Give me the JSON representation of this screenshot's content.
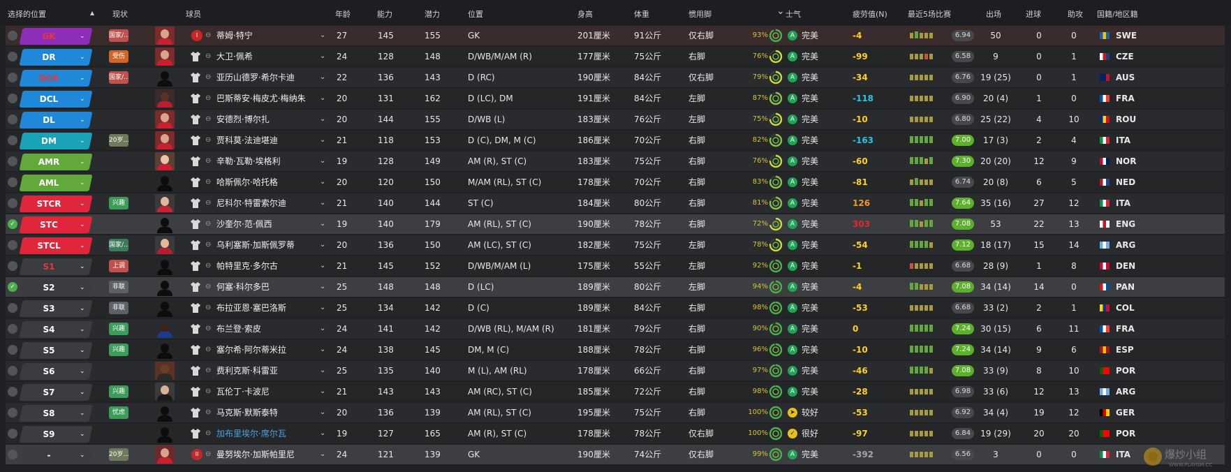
{
  "header": {
    "col_select": "选择的位置",
    "sort_indicator": "▲",
    "col_status": "现状",
    "col_player": "球员",
    "col_age": "年龄",
    "col_ability": "能力",
    "col_potential": "潜力",
    "col_position": "位置",
    "col_height": "身高",
    "col_weight": "体重",
    "col_foot": "惯用脚",
    "col_morale_arrow": "⌄",
    "col_morale": "士气",
    "col_value": "疲劳值(N)",
    "col_form": "最近5场比赛",
    "col_apps": "出场",
    "col_goals": "进球",
    "col_assists": "助攻",
    "col_nat": "国籍/地区籍"
  },
  "colors": {
    "red": "#e0263a",
    "blue": "#1f88d8",
    "teal": "#1aa3b8",
    "green": "#62a83a",
    "dark": "#3b3c40",
    "morale_icon_green": "#1ea453",
    "morale_icon_yellow": "#e3c01a",
    "value_yellow": "#ffd21f",
    "value_cyan": "#29c6dd",
    "value_orange": "#f29a1e",
    "value_red": "#e3262f",
    "value_grey": "#a4a5a8",
    "rating_green": "#5bb12a",
    "rating_grey": "#47484c"
  },
  "players": [
    {
      "pos": "GK",
      "pos_color": "#8e2dba",
      "pos_text": "#e53935",
      "status": "国家/...",
      "status_color": "#c0504d",
      "photo": "red",
      "badge": "I",
      "name": "蒂姆·特宁",
      "age": "27",
      "ca": "145",
      "pa": "155",
      "position": "GK",
      "height": "201厘米",
      "weight": "91公斤",
      "foot": "仅右脚",
      "morale_pct": "93%",
      "morale_icon": "A",
      "morale_icon_color": "#1ea453",
      "morale": "完美",
      "value": "-4",
      "value_color": "#ffd21f",
      "form": [
        "#a69a3d",
        "#62a83a",
        "#a69a3d",
        "#a69a3d",
        "#a69a3d"
      ],
      "rating": "6.94",
      "rating_hl": false,
      "apps": "50",
      "goals": "0",
      "assists": "0",
      "flag": [
        "#1f5fa8",
        "#f2c40f",
        "#1f5fa8"
      ],
      "nat": "SWE",
      "row": "gk"
    },
    {
      "pos": "DR",
      "pos_color": "#1f88d8",
      "pos_text": "#ffffff",
      "status": "受伤",
      "status_color": "#d0652a",
      "photo": "red",
      "name": "大卫·佩希",
      "age": "24",
      "ca": "128",
      "pa": "148",
      "position": "D/WB/M/AM (R)",
      "height": "177厘米",
      "weight": "75公斤",
      "foot": "右脚",
      "morale_pct": "76%",
      "morale_icon": "A",
      "morale_icon_color": "#1ea453",
      "morale": "完美",
      "value": "-99",
      "value_color": "#ffd21f",
      "form": [
        "#a69a3d",
        "#a69a3d",
        "#a69a3d",
        "#c7543c",
        "#a69a3d"
      ],
      "rating": "6.58",
      "rating_hl": false,
      "apps": "9",
      "goals": "0",
      "assists": "1",
      "flag": [
        "#ffffff",
        "#d7141a",
        "#11457e"
      ],
      "nat": "CZE",
      "row": "even"
    },
    {
      "pos": "DCR",
      "pos_color": "#1f88d8",
      "pos_text": "#e53935",
      "status": "国家/...",
      "status_color": "#c0504d",
      "photo": "none",
      "name": "亚历山德罗·希尔卡迪",
      "age": "22",
      "ca": "136",
      "pa": "143",
      "position": "D (RC)",
      "height": "190厘米",
      "weight": "84公斤",
      "foot": "仅右脚",
      "morale_pct": "79%",
      "morale_icon": "A",
      "morale_icon_color": "#1ea453",
      "morale": "完美",
      "value": "-34",
      "value_color": "#ffd21f",
      "form": [
        "#a69a3d",
        "#a69a3d",
        "#a69a3d",
        "#a69a3d",
        "#a69a3d"
      ],
      "rating": "6.76",
      "rating_hl": false,
      "apps": "19 (25)",
      "goals": "0",
      "assists": "1",
      "flag": [
        "#012169",
        "#012169",
        "#c8102e"
      ],
      "nat": "AUS",
      "row": "odd"
    },
    {
      "pos": "DCL",
      "pos_color": "#1f88d8",
      "pos_text": "#ffffff",
      "status": "",
      "status_color": "",
      "photo": "dark",
      "name": "巴斯蒂安·梅皮尤·梅纳朱",
      "age": "20",
      "ca": "131",
      "pa": "162",
      "position": "D (LC), DM",
      "height": "191厘米",
      "weight": "84公斤",
      "foot": "左脚",
      "morale_pct": "87%",
      "morale_icon": "A",
      "morale_icon_color": "#1ea453",
      "morale": "完美",
      "value": "-118",
      "value_color": "#29c6dd",
      "form": [
        "#a69a3d",
        "#a69a3d",
        "#a69a3d",
        "#a69a3d",
        "#a69a3d"
      ],
      "rating": "6.90",
      "rating_hl": false,
      "apps": "20 (4)",
      "goals": "1",
      "assists": "0",
      "flag": [
        "#0055a4",
        "#ffffff",
        "#ef4135"
      ],
      "nat": "FRA",
      "row": "even"
    },
    {
      "pos": "DL",
      "pos_color": "#1f88d8",
      "pos_text": "#ffffff",
      "status": "",
      "status_color": "",
      "photo": "red",
      "name": "安德烈·博尔扎",
      "age": "20",
      "ca": "144",
      "pa": "155",
      "position": "D/WB (L)",
      "height": "183厘米",
      "weight": "76公斤",
      "foot": "左脚",
      "morale_pct": "75%",
      "morale_icon": "A",
      "morale_icon_color": "#1ea453",
      "morale": "完美",
      "value": "-10",
      "value_color": "#ffd21f",
      "form": [
        "#a69a3d",
        "#a69a3d",
        "#a69a3d",
        "#a69a3d",
        "#a69a3d"
      ],
      "rating": "6.80",
      "rating_hl": false,
      "apps": "25 (22)",
      "goals": "4",
      "assists": "10",
      "flag": [
        "#002b7f",
        "#fcd116",
        "#ce1126"
      ],
      "nat": "ROU",
      "row": "odd"
    },
    {
      "pos": "DM",
      "pos_color": "#1aa3b8",
      "pos_text": "#ffffff",
      "status": "20岁...",
      "status_color": "#6f7a5c",
      "photo": "red",
      "name": "贾科莫·法迪堪迪",
      "age": "21",
      "ca": "118",
      "pa": "153",
      "position": "D (C), DM, M (C)",
      "height": "186厘米",
      "weight": "70公斤",
      "foot": "右脚",
      "morale_pct": "82%",
      "morale_icon": "A",
      "morale_icon_color": "#1ea453",
      "morale": "完美",
      "value": "-163",
      "value_color": "#29c6dd",
      "form": [
        "#62a83a",
        "#62a83a",
        "#62a83a",
        "#62a83a",
        "#62a83a"
      ],
      "rating": "7.00",
      "rating_hl": true,
      "apps": "17 (3)",
      "goals": "2",
      "assists": "4",
      "flag": [
        "#009246",
        "#ffffff",
        "#ce2b37"
      ],
      "nat": "ITA",
      "row": "even"
    },
    {
      "pos": "AMR",
      "pos_color": "#62a83a",
      "pos_text": "#ffffff",
      "status": "",
      "status_color": "",
      "photo": "pale",
      "name": "辛勒·瓦勒·埃格利",
      "age": "19",
      "ca": "128",
      "pa": "149",
      "position": "AM (R), ST (C)",
      "height": "183厘米",
      "weight": "75公斤",
      "foot": "右脚",
      "morale_pct": "76%",
      "morale_icon": "A",
      "morale_icon_color": "#1ea453",
      "morale": "完美",
      "value": "-60",
      "value_color": "#ffd21f",
      "form": [
        "#62a83a",
        "#62a83a",
        "#62a83a",
        "#a69a3d",
        "#62a83a"
      ],
      "rating": "7.30",
      "rating_hl": true,
      "apps": "20 (20)",
      "goals": "12",
      "assists": "9",
      "flag": [
        "#ba0c2f",
        "#ffffff",
        "#00205b"
      ],
      "nat": "NOR",
      "row": "odd"
    },
    {
      "pos": "AML",
      "pos_color": "#62a83a",
      "pos_text": "#ffffff",
      "status": "",
      "status_color": "",
      "photo": "none",
      "name": "哈斯佩尔·哈托格",
      "age": "20",
      "ca": "120",
      "pa": "150",
      "position": "M/AM (RL), ST (C)",
      "height": "178厘米",
      "weight": "70公斤",
      "foot": "右脚",
      "morale_pct": "83%",
      "morale_icon": "A",
      "morale_icon_color": "#1ea453",
      "morale": "完美",
      "value": "-81",
      "value_color": "#ffd21f",
      "form": [
        "#a69a3d",
        "#62a83a",
        "#a69a3d",
        "#a69a3d",
        "#a69a3d"
      ],
      "rating": "6.74",
      "rating_hl": false,
      "apps": "20 (8)",
      "goals": "6",
      "assists": "5",
      "flag": [
        "#ae1c28",
        "#ffffff",
        "#21468b"
      ],
      "nat": "NED",
      "row": "even"
    },
    {
      "pos": "STCR",
      "pos_color": "#e0263a",
      "pos_text": "#ffffff",
      "status": "兴趣",
      "status_color": "#3d9c5a",
      "photo": "pale2",
      "name": "尼科尔·特雷索尔迪",
      "age": "21",
      "ca": "140",
      "pa": "144",
      "position": "ST (C)",
      "height": "184厘米",
      "weight": "80公斤",
      "foot": "右脚",
      "morale_pct": "81%",
      "morale_icon": "A",
      "morale_icon_color": "#1ea453",
      "morale": "完美",
      "value": "126",
      "value_color": "#f29a1e",
      "form": [
        "#62a83a",
        "#62a83a",
        "#a69a3d",
        "#62a83a",
        "#62a83a"
      ],
      "rating": "7.64",
      "rating_hl": true,
      "apps": "35 (16)",
      "goals": "27",
      "assists": "12",
      "flag": [
        "#009246",
        "#ffffff",
        "#ce2b37"
      ],
      "nat": "ITA",
      "row": "odd"
    },
    {
      "pos": "STC",
      "pos_color": "#e0263a",
      "pos_text": "#ffffff",
      "status": "",
      "status_color": "",
      "photo": "none",
      "name": "沙奎尔·范·佩西",
      "age": "19",
      "ca": "140",
      "pa": "179",
      "position": "AM (RL), ST (C)",
      "height": "190厘米",
      "weight": "78公斤",
      "foot": "右脚",
      "morale_pct": "72%",
      "morale_icon": "A",
      "morale_icon_color": "#1ea453",
      "morale": "完美",
      "value": "303",
      "value_color": "#e3262f",
      "form": [
        "#62a83a",
        "#62a83a",
        "#a69a3d",
        "#62a83a",
        "#62a83a"
      ],
      "rating": "7.08",
      "rating_hl": true,
      "apps": "53",
      "goals": "22",
      "assists": "13",
      "flag": [
        "#ffffff",
        "#ce1124",
        "#ffffff"
      ],
      "nat": "ENG",
      "row": "sel",
      "checked": true
    },
    {
      "pos": "STCL",
      "pos_color": "#e0263a",
      "pos_text": "#ffffff",
      "status": "国家/...",
      "status_color": "#3d7a5a",
      "photo": "pale3",
      "name": "乌利塞斯·加斯佩罗蒂",
      "age": "20",
      "ca": "136",
      "pa": "150",
      "position": "AM (LC), ST (C)",
      "height": "182厘米",
      "weight": "75公斤",
      "foot": "左脚",
      "morale_pct": "78%",
      "morale_icon": "A",
      "morale_icon_color": "#1ea453",
      "morale": "完美",
      "value": "-54",
      "value_color": "#ffd21f",
      "form": [
        "#62a83a",
        "#62a83a",
        "#62a83a",
        "#62a83a",
        "#a69a3d"
      ],
      "rating": "7.12",
      "rating_hl": true,
      "apps": "18 (17)",
      "goals": "15",
      "assists": "14",
      "flag": [
        "#74acdf",
        "#ffffff",
        "#74acdf"
      ],
      "nat": "ARG",
      "row": "odd"
    },
    {
      "pos": "S1",
      "pos_color": "#3b3c40",
      "pos_text": "#e53935",
      "status": "上调",
      "status_color": "#c0504d",
      "photo": "none",
      "name": "帕特里克·多尔古",
      "age": "21",
      "ca": "145",
      "pa": "152",
      "position": "D/WB/M/AM (L)",
      "height": "175厘米",
      "weight": "55公斤",
      "foot": "左脚",
      "morale_pct": "92%",
      "morale_icon": "A",
      "morale_icon_color": "#1ea453",
      "morale": "完美",
      "value": "-1",
      "value_color": "#ffd21f",
      "form": [
        "#c7543c",
        "#a69a3d",
        "#a69a3d",
        "#a69a3d",
        "#a69a3d"
      ],
      "rating": "6.68",
      "rating_hl": false,
      "apps": "28 (9)",
      "goals": "1",
      "assists": "8",
      "flag": [
        "#c60c30",
        "#ffffff",
        "#c60c30"
      ],
      "nat": "DEN",
      "row": "even"
    },
    {
      "pos": "S2",
      "pos_color": "#3b3c40",
      "pos_text": "#ffffff",
      "status": "非联",
      "status_color": "#5d6066",
      "photo": "none",
      "name": "何塞·科尔多巴",
      "age": "25",
      "ca": "148",
      "pa": "148",
      "position": "D (LC)",
      "height": "189厘米",
      "weight": "80公斤",
      "foot": "左脚",
      "morale_pct": "94%",
      "morale_icon": "A",
      "morale_icon_color": "#1ea453",
      "morale": "完美",
      "value": "-4",
      "value_color": "#ffd21f",
      "form": [
        "#62a83a",
        "#62a83a",
        "#a69a3d",
        "#a69a3d",
        "#a69a3d"
      ],
      "rating": "7.08",
      "rating_hl": true,
      "apps": "34 (14)",
      "goals": "14",
      "assists": "0",
      "flag": [
        "#da121a",
        "#ffffff",
        "#005293"
      ],
      "nat": "PAN",
      "row": "sel",
      "checked": true
    },
    {
      "pos": "S3",
      "pos_color": "#3b3c40",
      "pos_text": "#ffffff",
      "status": "非联",
      "status_color": "#5d6066",
      "photo": "none",
      "name": "布拉亚恩·塞巴洛斯",
      "age": "25",
      "ca": "134",
      "pa": "142",
      "position": "D (C)",
      "height": "189厘米",
      "weight": "84公斤",
      "foot": "右脚",
      "morale_pct": "98%",
      "morale_icon": "A",
      "morale_icon_color": "#1ea453",
      "morale": "完美",
      "value": "-53",
      "value_color": "#ffd21f",
      "form": [
        "#a69a3d",
        "#a69a3d",
        "#a69a3d",
        "#a69a3d",
        "#a69a3d"
      ],
      "rating": "6.68",
      "rating_hl": false,
      "apps": "33 (2)",
      "goals": "2",
      "assists": "1",
      "flag": [
        "#fcd116",
        "#003893",
        "#ce1126"
      ],
      "nat": "COL",
      "row": "even"
    },
    {
      "pos": "S4",
      "pos_color": "#3b3c40",
      "pos_text": "#ffffff",
      "status": "兴趣",
      "status_color": "#3d9c5a",
      "photo": "dark2",
      "name": "布兰登·索皮",
      "age": "24",
      "ca": "141",
      "pa": "142",
      "position": "D/WB (RL), M/AM (R)",
      "height": "181厘米",
      "weight": "79公斤",
      "foot": "右脚",
      "morale_pct": "90%",
      "morale_icon": "A",
      "morale_icon_color": "#1ea453",
      "morale": "完美",
      "value": "0",
      "value_color": "#ffd21f",
      "form": [
        "#62a83a",
        "#62a83a",
        "#62a83a",
        "#62a83a",
        "#62a83a"
      ],
      "rating": "7.24",
      "rating_hl": true,
      "apps": "30 (15)",
      "goals": "6",
      "assists": "11",
      "flag": [
        "#0055a4",
        "#ffffff",
        "#ef4135"
      ],
      "nat": "FRA",
      "row": "odd"
    },
    {
      "pos": "S5",
      "pos_color": "#3b3c40",
      "pos_text": "#ffffff",
      "status": "兴趣",
      "status_color": "#3d9c5a",
      "photo": "none",
      "name": "塞尔希·阿尔蒂米拉",
      "age": "24",
      "ca": "138",
      "pa": "145",
      "position": "DM, M (C)",
      "height": "188厘米",
      "weight": "78公斤",
      "foot": "右脚",
      "morale_pct": "96%",
      "morale_icon": "A",
      "morale_icon_color": "#1ea453",
      "morale": "完美",
      "value": "-10",
      "value_color": "#ffd21f",
      "form": [
        "#62a83a",
        "#62a83a",
        "#62a83a",
        "#62a83a",
        "#62a83a"
      ],
      "rating": "7.24",
      "rating_hl": true,
      "apps": "34 (14)",
      "goals": "9",
      "assists": "6",
      "flag": [
        "#aa151b",
        "#f1bf00",
        "#aa151b"
      ],
      "nat": "ESP",
      "row": "even"
    },
    {
      "pos": "S6",
      "pos_color": "#3b3c40",
      "pos_text": "#ffffff",
      "status": "",
      "status_color": "",
      "photo": "dark3",
      "name": "费利克斯·科雷亚",
      "age": "25",
      "ca": "135",
      "pa": "140",
      "position": "M (L), AM (RL)",
      "height": "178厘米",
      "weight": "66公斤",
      "foot": "右脚",
      "morale_pct": "97%",
      "morale_icon": "A",
      "morale_icon_color": "#1ea453",
      "morale": "完美",
      "value": "-46",
      "value_color": "#ffd21f",
      "form": [
        "#62a83a",
        "#62a83a",
        "#62a83a",
        "#62a83a",
        "#a69a3d"
      ],
      "rating": "7.08",
      "rating_hl": true,
      "apps": "33 (9)",
      "goals": "8",
      "assists": "10",
      "flag": [
        "#006600",
        "#ff0000",
        "#ff0000"
      ],
      "nat": "POR",
      "row": "odd"
    },
    {
      "pos": "S7",
      "pos_color": "#3b3c40",
      "pos_text": "#ffffff",
      "status": "兴趣",
      "status_color": "#3d9c5a",
      "photo": "dark4",
      "name": "瓦伦丁·卡波尼",
      "age": "21",
      "ca": "143",
      "pa": "143",
      "position": "AM (RC), ST (C)",
      "height": "185厘米",
      "weight": "72公斤",
      "foot": "右脚",
      "morale_pct": "98%",
      "morale_icon": "A",
      "morale_icon_color": "#1ea453",
      "morale": "完美",
      "value": "-28",
      "value_color": "#ffd21f",
      "form": [
        "#a69a3d",
        "#a69a3d",
        "#a69a3d",
        "#a69a3d",
        "#a69a3d"
      ],
      "rating": "6.98",
      "rating_hl": false,
      "apps": "33 (6)",
      "goals": "12",
      "assists": "13",
      "flag": [
        "#74acdf",
        "#ffffff",
        "#74acdf"
      ],
      "nat": "ARG",
      "row": "even"
    },
    {
      "pos": "S8",
      "pos_color": "#3b3c40",
      "pos_text": "#ffffff",
      "status": "忧虑",
      "status_color": "#3d9c5a",
      "photo": "none",
      "name": "马克斯·默斯泰特",
      "age": "20",
      "ca": "136",
      "pa": "139",
      "position": "AM (RL), ST (C)",
      "height": "195厘米",
      "weight": "75公斤",
      "foot": "右脚",
      "morale_pct": "100%",
      "morale_icon": "➤",
      "morale_icon_color": "#e3c01a",
      "morale": "较好",
      "value": "-53",
      "value_color": "#ffd21f",
      "form": [
        "#a69a3d",
        "#a69a3d",
        "#a69a3d",
        "#a69a3d",
        "#a69a3d"
      ],
      "rating": "6.92",
      "rating_hl": false,
      "apps": "34 (4)",
      "goals": "19",
      "assists": "12",
      "flag": [
        "#000000",
        "#dd0000",
        "#ffce00"
      ],
      "nat": "GER",
      "row": "odd"
    },
    {
      "pos": "S9",
      "pos_color": "#3b3c40",
      "pos_text": "#ffffff",
      "status": "",
      "status_color": "",
      "photo": "none",
      "name": "加布里埃尔·席尔瓦",
      "name_link": true,
      "age": "19",
      "ca": "127",
      "pa": "165",
      "position": "AM (R), ST (C)",
      "height": "178厘米",
      "weight": "78公斤",
      "foot": "仅右脚",
      "morale_pct": "100%",
      "morale_icon": "✓",
      "morale_icon_color": "#e3c01a",
      "morale": "很好",
      "value": "-97",
      "value_color": "#ffd21f",
      "form": [
        "#a69a3d",
        "#a69a3d",
        "#a69a3d",
        "#a69a3d",
        "#a69a3d"
      ],
      "rating": "6.84",
      "rating_hl": false,
      "apps": "19 (29)",
      "goals": "20",
      "assists": "20",
      "flag": [
        "#006600",
        "#ff0000",
        "#ff0000"
      ],
      "nat": "POR",
      "row": "even"
    },
    {
      "pos": "-",
      "pos_color": "#3b3c40",
      "pos_text": "#ffffff",
      "status": "20岁...",
      "status_color": "#6f7a5c",
      "photo": "red2",
      "badge": "II",
      "name": "曼努埃尔·加斯帕里尼",
      "age": "24",
      "ca": "121",
      "pa": "139",
      "position": "GK",
      "height": "190厘米",
      "weight": "74公斤",
      "foot": "仅右脚",
      "morale_pct": "99%",
      "morale_icon": "A",
      "morale_icon_color": "#1ea453",
      "morale": "完美",
      "value": "-392",
      "value_color": "#a4a5a8",
      "form": [
        "#a69a3d",
        "#a69a3d",
        "#a69a3d",
        "#a69a3d",
        "#a69a3d"
      ],
      "rating": "6.56",
      "rating_hl": false,
      "apps": "3",
      "goals": "0",
      "assists": "0",
      "flag": [
        "#009246",
        "#ffffff",
        "#ce2b37"
      ],
      "nat": "ITA",
      "row": "sel"
    }
  ],
  "watermark": {
    "text": "爆炒小组",
    "url": "WWW.PLAYGM.CC"
  }
}
